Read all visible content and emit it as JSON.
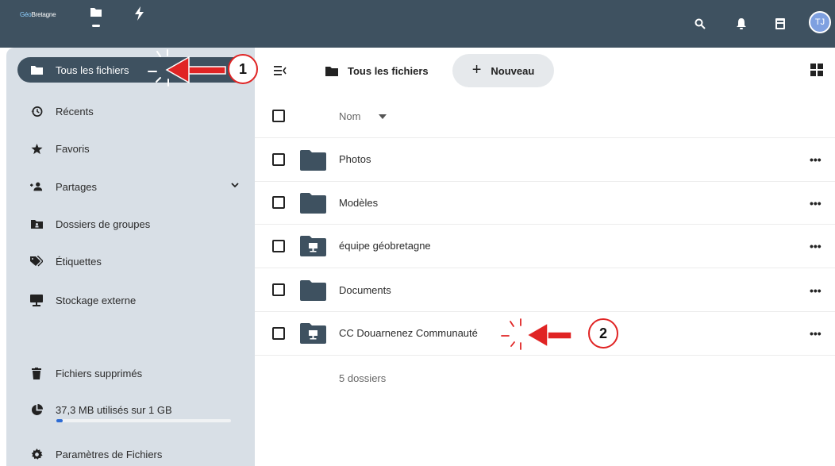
{
  "header": {
    "logo_prefix": "Géo",
    "logo_suffix": "Bretagne",
    "apps": [
      {
        "name": "files-app",
        "icon": "folder-icon",
        "active": true
      },
      {
        "name": "activity-app",
        "icon": "lightning-icon",
        "active": false
      }
    ],
    "right_icons": [
      "search-icon",
      "bell-icon",
      "contacts-icon"
    ],
    "avatar_initials": "TJ"
  },
  "sidebar": {
    "items": [
      {
        "label": "Tous les fichiers",
        "icon": "folder-icon",
        "active": true
      },
      {
        "label": "Récents",
        "icon": "history-icon"
      },
      {
        "label": "Favoris",
        "icon": "star-icon"
      },
      {
        "label": "Partages",
        "icon": "share-icon",
        "has_chevron": true
      },
      {
        "label": "Dossiers de groupes",
        "icon": "group-folder-icon"
      },
      {
        "label": "Étiquettes",
        "icon": "tag-icon"
      },
      {
        "label": "Stockage externe",
        "icon": "external-storage-icon"
      },
      {
        "label": "Fichiers supprimés",
        "icon": "trash-icon"
      },
      {
        "label": "37,3 MB utilisés sur 1 GB",
        "icon": "pie-chart-icon"
      },
      {
        "label": "Paramètres de Fichiers",
        "icon": "gear-icon"
      }
    ],
    "quota_fraction": 0.037
  },
  "toolbar": {
    "breadcrumb_label": "Tous les fichiers",
    "new_label": "Nouveau",
    "new_symbol": "+"
  },
  "table": {
    "column_name": "Nom",
    "rows": [
      {
        "name": "Photos",
        "icon": "folder-icon"
      },
      {
        "name": "Modèles",
        "icon": "folder-icon"
      },
      {
        "name": "équipe géobretagne",
        "icon": "shared-folder-icon"
      },
      {
        "name": "Documents",
        "icon": "folder-icon"
      },
      {
        "name": "CC Douarnenez Communauté",
        "icon": "shared-folder-icon"
      }
    ],
    "more_symbol": "•••",
    "summary": "5 dossiers"
  },
  "annotations": [
    {
      "number": "1"
    },
    {
      "number": "2"
    }
  ],
  "colors": {
    "header_bg": "#3e5160",
    "sidebar_bg": "#d8dfe6",
    "active_item_bg": "#3e5160",
    "folder": "#3e5160",
    "annotation_red": "#e02424",
    "quota_fill": "#2d6bd4"
  }
}
